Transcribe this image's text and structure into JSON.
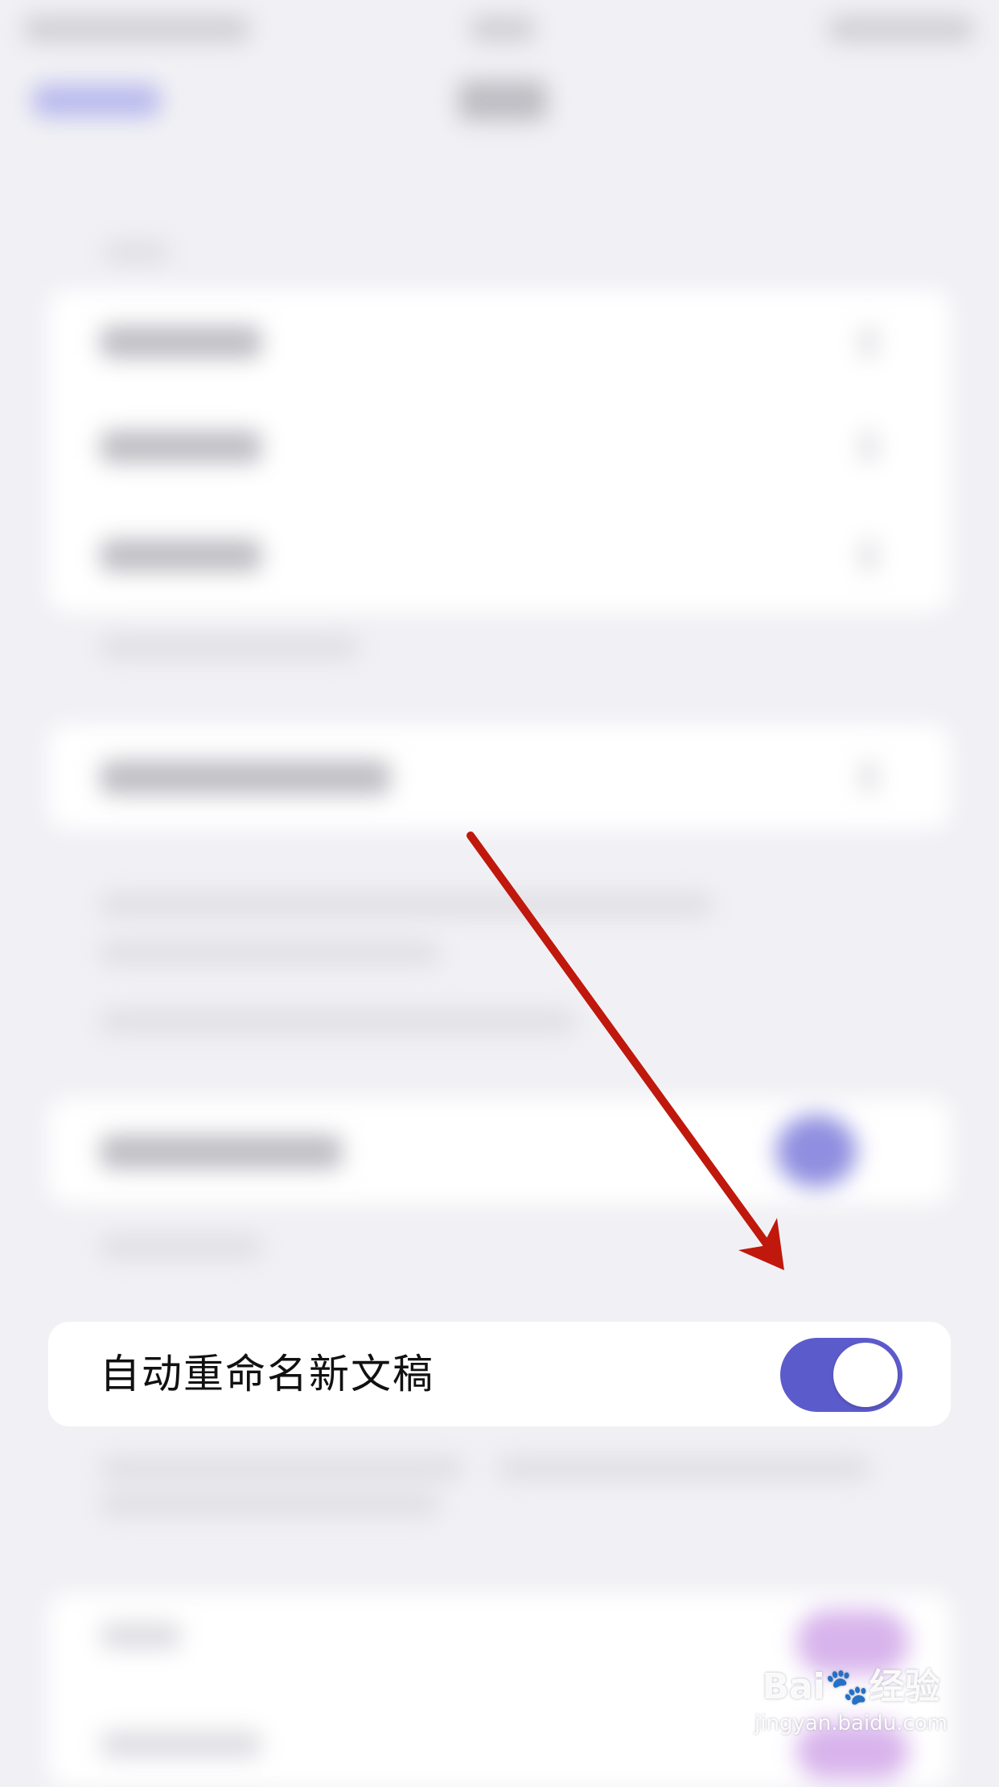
{
  "setting_row": {
    "label": "自动重命名新文稿",
    "enabled": true
  },
  "colors": {
    "background": "#f1f1f5",
    "toggle_on": "#5c5bcc",
    "arrow": "#c0180c",
    "purple_blur": "#d8b4ec"
  },
  "icons": {
    "arrow": "arrow-annotation-icon",
    "watermark": "baidu-jingyan-watermark"
  }
}
